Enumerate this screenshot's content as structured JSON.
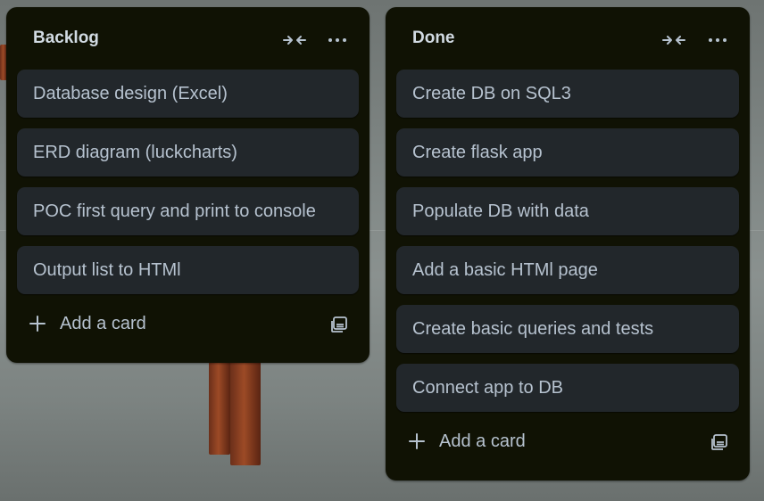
{
  "lists": [
    {
      "title": "Backlog",
      "cards": [
        "Database design (Excel)",
        "ERD diagram (luckcharts)",
        "POC first query and print to console",
        "Output list to HTMl"
      ],
      "add_card_label": "Add a card"
    },
    {
      "title": "Done",
      "cards": [
        "Create DB on SQL3",
        "Create flask app",
        "Populate DB with data",
        "Add a basic HTMl page",
        "Create basic queries and tests",
        "Connect app to DB"
      ],
      "add_card_label": "Add a card"
    }
  ],
  "icons": {
    "collapse": "collapse-arrows-icon",
    "more": "more-horizontal-icon",
    "add": "plus-icon",
    "template": "card-template-icon"
  },
  "colors": {
    "list_bg": "#101204",
    "card_bg": "#22272b",
    "text": "#b6c2cf",
    "title_text": "#d2dbe3"
  }
}
